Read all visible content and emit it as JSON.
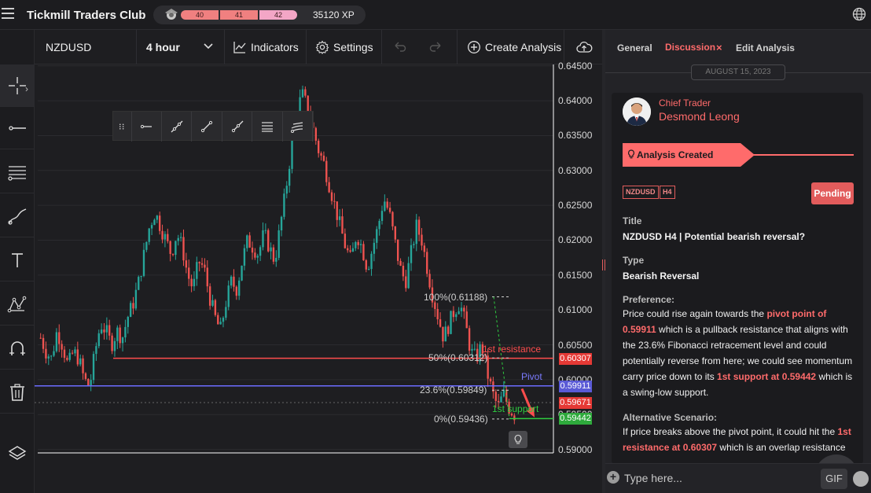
{
  "app": {
    "title": "Tickmill Traders Club",
    "xp_segments": [
      "40",
      "41",
      "42"
    ],
    "xp_value": "35120 XP"
  },
  "toolbar": {
    "symbol": "NZDUSD",
    "timeframe": "4 hour",
    "indicators_label": "Indicators",
    "settings_label": "Settings",
    "create_label": "Create Analysis"
  },
  "chart_data": {
    "type": "candlestick",
    "symbol": "NZDUSD",
    "timeframe": "4 hour",
    "ylim": [
      0.5895,
      0.6452
    ],
    "y_ticks": [
      "0.64500",
      "0.64000",
      "0.63500",
      "0.63000",
      "0.62500",
      "0.62000",
      "0.61500",
      "0.61000",
      "0.60500",
      "0.60000",
      "0.59500",
      "0.59000"
    ],
    "y_tick_values": [
      0.645,
      0.64,
      0.635,
      0.63,
      0.625,
      0.62,
      0.615,
      0.61,
      0.605,
      0.6,
      0.595,
      0.59
    ],
    "close_path": [
      0.606,
      0.604,
      0.603,
      0.607,
      0.605,
      0.602,
      0.604,
      0.603,
      0.6,
      0.599,
      0.604,
      0.608,
      0.607,
      0.605,
      0.607,
      0.606,
      0.609,
      0.611,
      0.614,
      0.618,
      0.622,
      0.624,
      0.622,
      0.62,
      0.618,
      0.621,
      0.619,
      0.615,
      0.613,
      0.617,
      0.616,
      0.612,
      0.609,
      0.607,
      0.611,
      0.614,
      0.613,
      0.617,
      0.62,
      0.619,
      0.618,
      0.621,
      0.619,
      0.617,
      0.622,
      0.627,
      0.633,
      0.638,
      0.641,
      0.639,
      0.636,
      0.633,
      0.631,
      0.628,
      0.625,
      0.622,
      0.619,
      0.617,
      0.621,
      0.619,
      0.616,
      0.619,
      0.622,
      0.626,
      0.624,
      0.62,
      0.616,
      0.614,
      0.618,
      0.622,
      0.62,
      0.616,
      0.612,
      0.609,
      0.606,
      0.608,
      0.61,
      0.611,
      0.608,
      0.604,
      0.603,
      0.605,
      0.601,
      0.598,
      0.596,
      0.598,
      0.596,
      0.595
    ],
    "levels": [
      {
        "name": "1st resistance",
        "value": 0.60307,
        "color": "#ff4d4d",
        "tag": "0.60307"
      },
      {
        "name": "Pivot",
        "value": 0.59911,
        "color": "#6c6cff",
        "tag": "0.59911"
      },
      {
        "name": "1st support",
        "value": 0.59442,
        "color": "#2ecc40",
        "tag": "0.59442"
      }
    ],
    "current_price": {
      "value": 0.59671,
      "tag": "0.59671"
    },
    "fibonacci": [
      {
        "label": "100%(0.61188)",
        "value": 0.61188
      },
      {
        "label": "50%(0.60312)",
        "value": 0.60312
      },
      {
        "label": "23.6%(0.59849)",
        "value": 0.59849
      },
      {
        "label": "0%(0.59436)",
        "value": 0.59436
      }
    ],
    "colors": {
      "up": "#26a69a",
      "down": "#ef5350",
      "grid": "#2b2b2f",
      "axis": "#ffffff"
    }
  },
  "panel": {
    "tabs": {
      "general": "General",
      "discussion": "Discussion",
      "close": "×",
      "edit": "Edit Analysis"
    },
    "date": "AUGUST 15, 2023",
    "author_role": "Chief Trader",
    "author_name": "Desmond Leong",
    "created": "Analysis Created",
    "tags": [
      "NZDUSD",
      "H4"
    ],
    "status": "Pending",
    "title_label": "Title",
    "title_value": "NZDUSD H4 | Potential bearish reversal?",
    "type_label": "Type",
    "type_value": "Bearish Reversal",
    "preference_label": "Preference:",
    "preference": {
      "p1": "Price could rise again towards the ",
      "h1": "pivot point of 0.59911",
      "p2": " which is a pullback resistance that aligns with the 23.6% Fibonacci retracement level and could potentially reverse from here; we could see momentum carry price down to its ",
      "h2": "1st support at 0.59442",
      "p3": " which is a swing-low support."
    },
    "alt_label": "Alternative Scenario:",
    "alt": {
      "p1": "If price breaks above the pivot point, it could hit the ",
      "h1": "1st resistance at 0.60307",
      "p2": " which is an overlap resistance"
    },
    "composer_placeholder": "Type here...",
    "gif_label": "GIF",
    "accent": "#ff6b6b"
  }
}
